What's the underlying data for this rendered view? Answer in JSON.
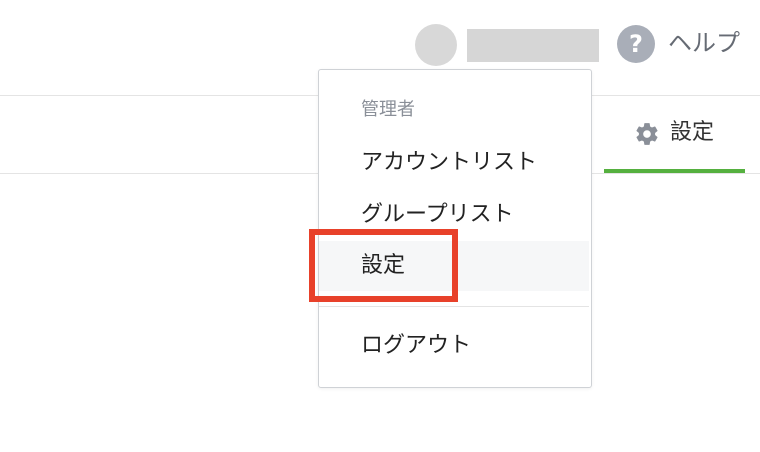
{
  "header": {
    "help_icon": "question-mark-icon",
    "help_icon_glyph": "?",
    "help_label": "ヘルプ"
  },
  "tabs": {
    "settings": {
      "icon": "gear-icon",
      "label": "設定",
      "active": true,
      "underline_color": "#55b03f"
    }
  },
  "dropdown": {
    "section_header": "管理者",
    "items": [
      {
        "label": "アカウントリスト"
      },
      {
        "label": "グループリスト"
      },
      {
        "label": "設定",
        "highlighted": true
      },
      {
        "label": "ログアウト"
      }
    ]
  },
  "annotation": {
    "highlight_color": "#e8412a"
  }
}
